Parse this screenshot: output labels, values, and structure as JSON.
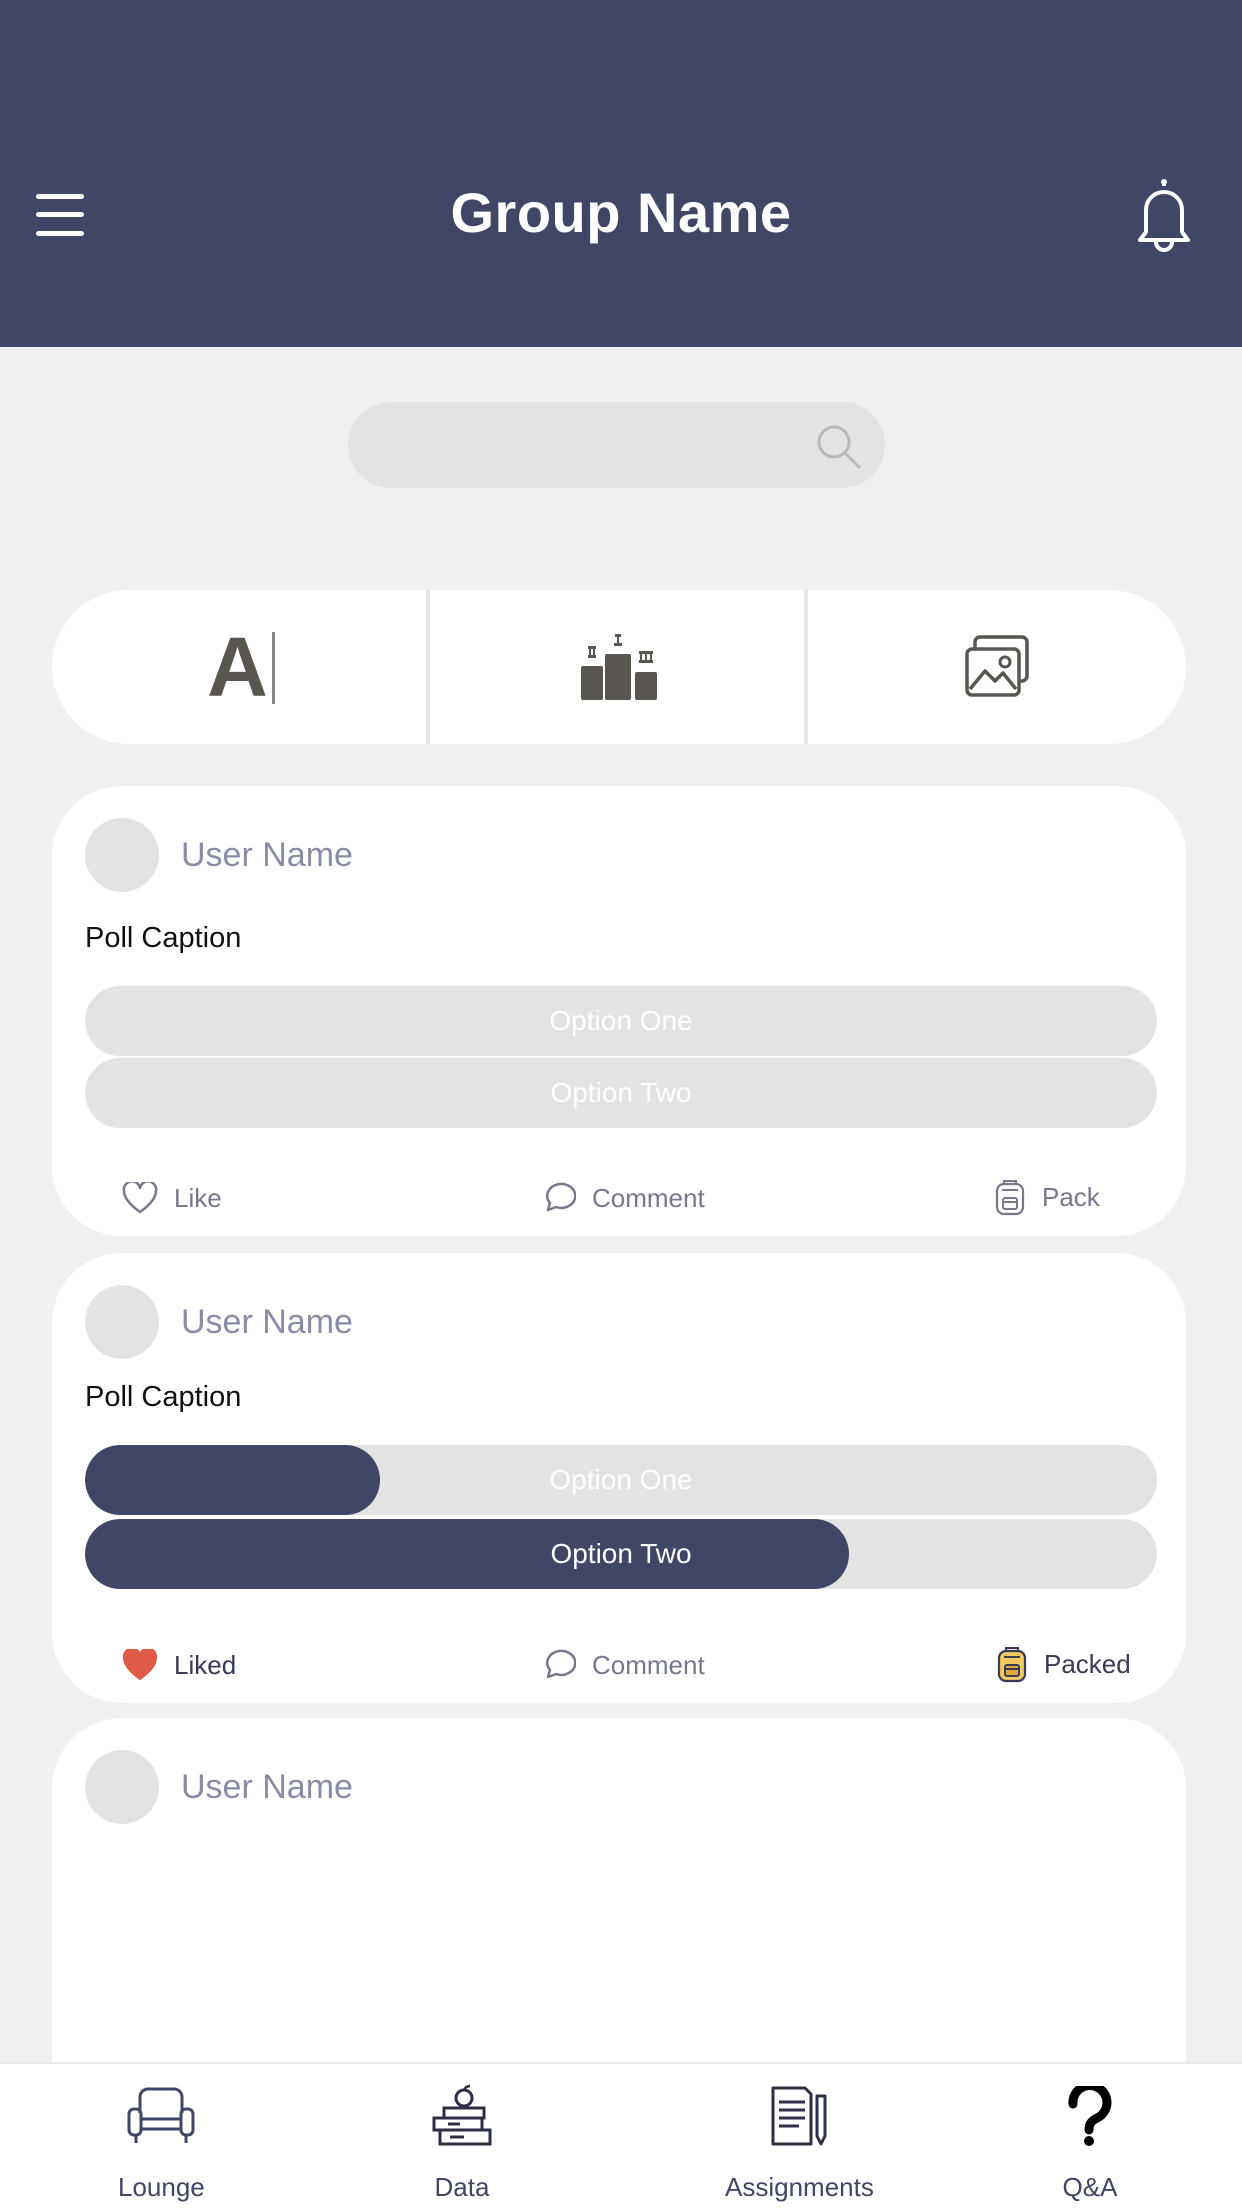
{
  "header": {
    "title": "Group Name",
    "menu_icon": "hamburger-menu-icon",
    "bell_icon": "bell-icon",
    "background": "#414566"
  },
  "search": {
    "value": "",
    "placeholder": ""
  },
  "post_types": [
    {
      "name": "text-post",
      "icon": "text-icon",
      "glyph": "A"
    },
    {
      "name": "poll-post",
      "icon": "podium-icon"
    },
    {
      "name": "image-post",
      "icon": "image-gallery-icon"
    }
  ],
  "posts": [
    {
      "user_name": "User Name",
      "caption": "Poll Caption",
      "options": [
        {
          "label": "Option One",
          "fill": 0
        },
        {
          "label": "Option Two",
          "fill": 0
        }
      ],
      "like_label": "Like",
      "comment_label": "Comment",
      "pack_label": "Pack"
    },
    {
      "user_name": "User Name",
      "caption": "Poll Caption",
      "options": [
        {
          "label": "Option One",
          "fill": 0.275
        },
        {
          "label": "Option Two",
          "fill": 0.713
        }
      ],
      "like_label": "Liked",
      "comment_label": "Comment",
      "pack_label": "Packed"
    },
    {
      "user_name": "User Name"
    }
  ],
  "colors": {
    "accent": "#414566",
    "liked": "#e05a4a",
    "packed": "#f2c960",
    "muted": "#e3e3e3"
  },
  "bottom_nav": [
    {
      "label": "Lounge",
      "icon": "armchair-icon"
    },
    {
      "label": "Data",
      "icon": "books-apple-icon"
    },
    {
      "label": "Assignments",
      "icon": "document-pencil-icon"
    },
    {
      "label": "Q&A",
      "icon": "question-mark-icon"
    }
  ]
}
